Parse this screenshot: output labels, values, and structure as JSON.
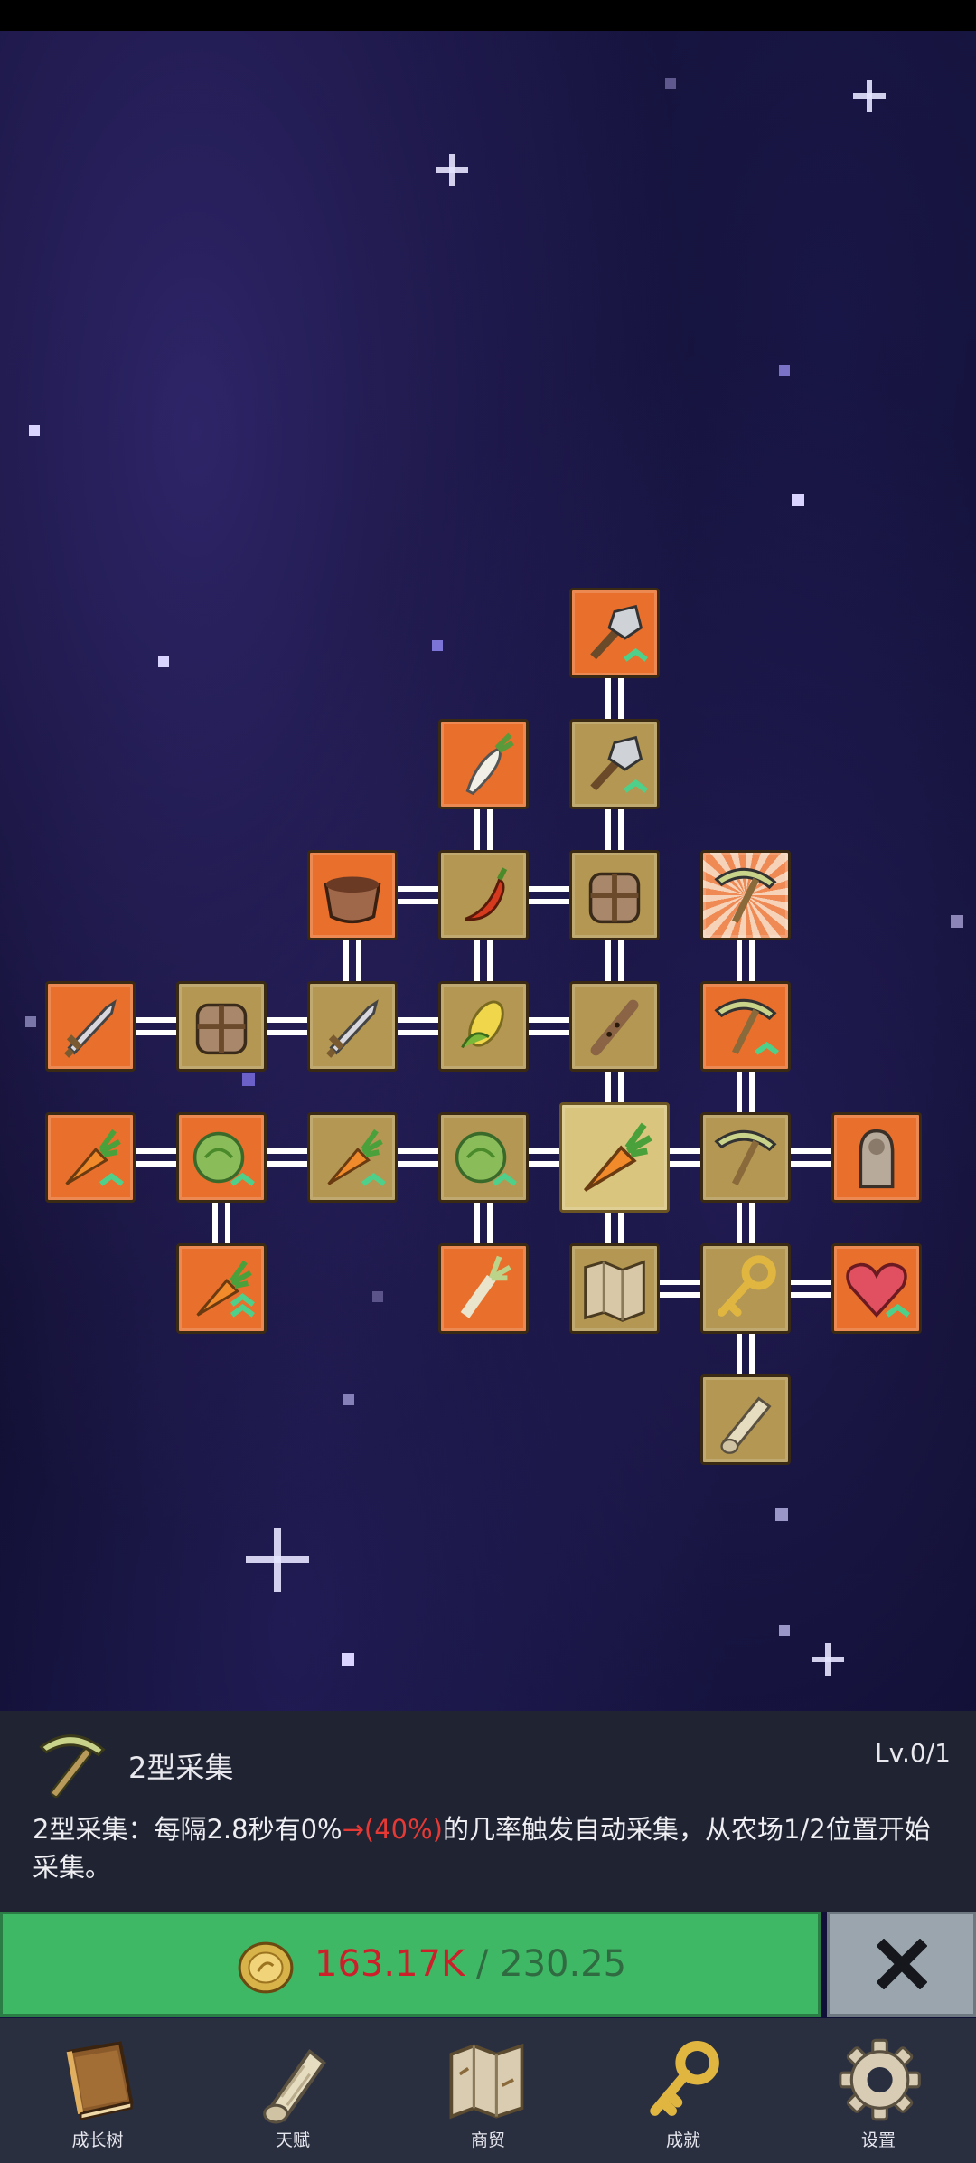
{
  "skill": {
    "name": "2型采集",
    "level": "Lv.0/1",
    "desc_before": "2型采集：每隔2.8秒有0%",
    "desc_highlight": "→(40%)",
    "desc_after": "的几率触发自动采集，从农场1/2位置开始采集。"
  },
  "cost": {
    "price": "163.17K",
    "separator": "/",
    "owned": "230.25"
  },
  "nav": [
    {
      "label": "成长树",
      "icon": "book-icon"
    },
    {
      "label": "天赋",
      "icon": "scroll-icon"
    },
    {
      "label": "商贸",
      "icon": "map-icon"
    },
    {
      "label": "成就",
      "icon": "key-icon"
    },
    {
      "label": "设置",
      "icon": "gear-icon"
    }
  ],
  "colors": {
    "unlocked": "#e86f2c",
    "locked": "#b39752",
    "selected": "#d9c57e",
    "buy": "#3fb866",
    "highlight": "#e53935"
  },
  "tree_nodes": [
    {
      "icon": "shovel-up-icon",
      "state": "unlocked"
    },
    {
      "icon": "radish-icon",
      "state": "unlocked"
    },
    {
      "icon": "shovel-up-icon",
      "state": "locked"
    },
    {
      "icon": "pot-icon",
      "state": "unlocked"
    },
    {
      "icon": "chili-icon",
      "state": "locked"
    },
    {
      "icon": "backpack-icon",
      "state": "locked"
    },
    {
      "icon": "pickaxe-icon",
      "state": "highlighted"
    },
    {
      "icon": "sword-icon",
      "state": "unlocked"
    },
    {
      "icon": "backpack-icon",
      "state": "locked"
    },
    {
      "icon": "sword-icon",
      "state": "locked"
    },
    {
      "icon": "corn-icon",
      "state": "locked"
    },
    {
      "icon": "flute-icon",
      "state": "locked"
    },
    {
      "icon": "pickaxe-up-icon",
      "state": "unlocked"
    },
    {
      "icon": "carrot-up-icon",
      "state": "unlocked"
    },
    {
      "icon": "cabbage-up-icon",
      "state": "unlocked"
    },
    {
      "icon": "carrot-up-icon",
      "state": "locked"
    },
    {
      "icon": "cabbage-up-icon",
      "state": "locked"
    },
    {
      "icon": "carrot-icon",
      "state": "selected"
    },
    {
      "icon": "pickaxe-icon",
      "state": "locked"
    },
    {
      "icon": "statue-icon",
      "state": "unlocked"
    },
    {
      "icon": "carrot-up2-icon",
      "state": "unlocked"
    },
    {
      "icon": "leek-icon",
      "state": "unlocked"
    },
    {
      "icon": "map-icon",
      "state": "locked"
    },
    {
      "icon": "key-icon",
      "state": "locked"
    },
    {
      "icon": "heart-up-icon",
      "state": "unlocked"
    },
    {
      "icon": "scroll-icon",
      "state": "locked"
    }
  ]
}
